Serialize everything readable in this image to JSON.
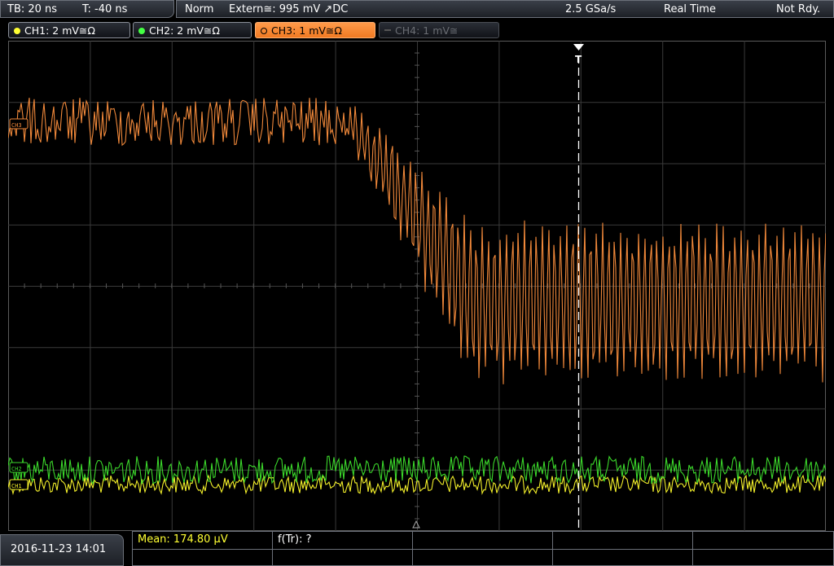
{
  "topbar": {
    "timebase": "TB: 20 ns",
    "trigger_time": "T: -40 ns",
    "trigger_mode": "Norm",
    "trigger_source": "Extern≅: 995 mV ↗DC",
    "sample_rate": "2.5 GSa/s",
    "acquisition_mode": "Real Time",
    "status": "Not Rdy."
  },
  "channels": [
    {
      "label": "CH1: 2 mV≅Ω",
      "color": "#ffff33",
      "active": true
    },
    {
      "label": "CH2: 2 mV≅Ω",
      "color": "#44ff44",
      "active": true
    },
    {
      "label": "CH3: 1 mV≅Ω",
      "color": "#ff8a3d",
      "active": true
    },
    {
      "label": "CH4: 1 mV≅",
      "color": "#6a6d73",
      "active": false
    }
  ],
  "markers": {
    "ch3": "CH3",
    "ch2": "CH2",
    "ch1": "CH1",
    "trigger": "T"
  },
  "bottom": {
    "datetime": "2016-11-23 14:01",
    "mean": "Mean: 174.80 µV",
    "ftr": "f(Tr): ?"
  },
  "colors": {
    "ch1": "#f2ef2a",
    "ch2": "#3bd82b",
    "ch3": "#f0883a",
    "grid": "#3a3a3a",
    "trigger_line": "#ffffff"
  }
}
